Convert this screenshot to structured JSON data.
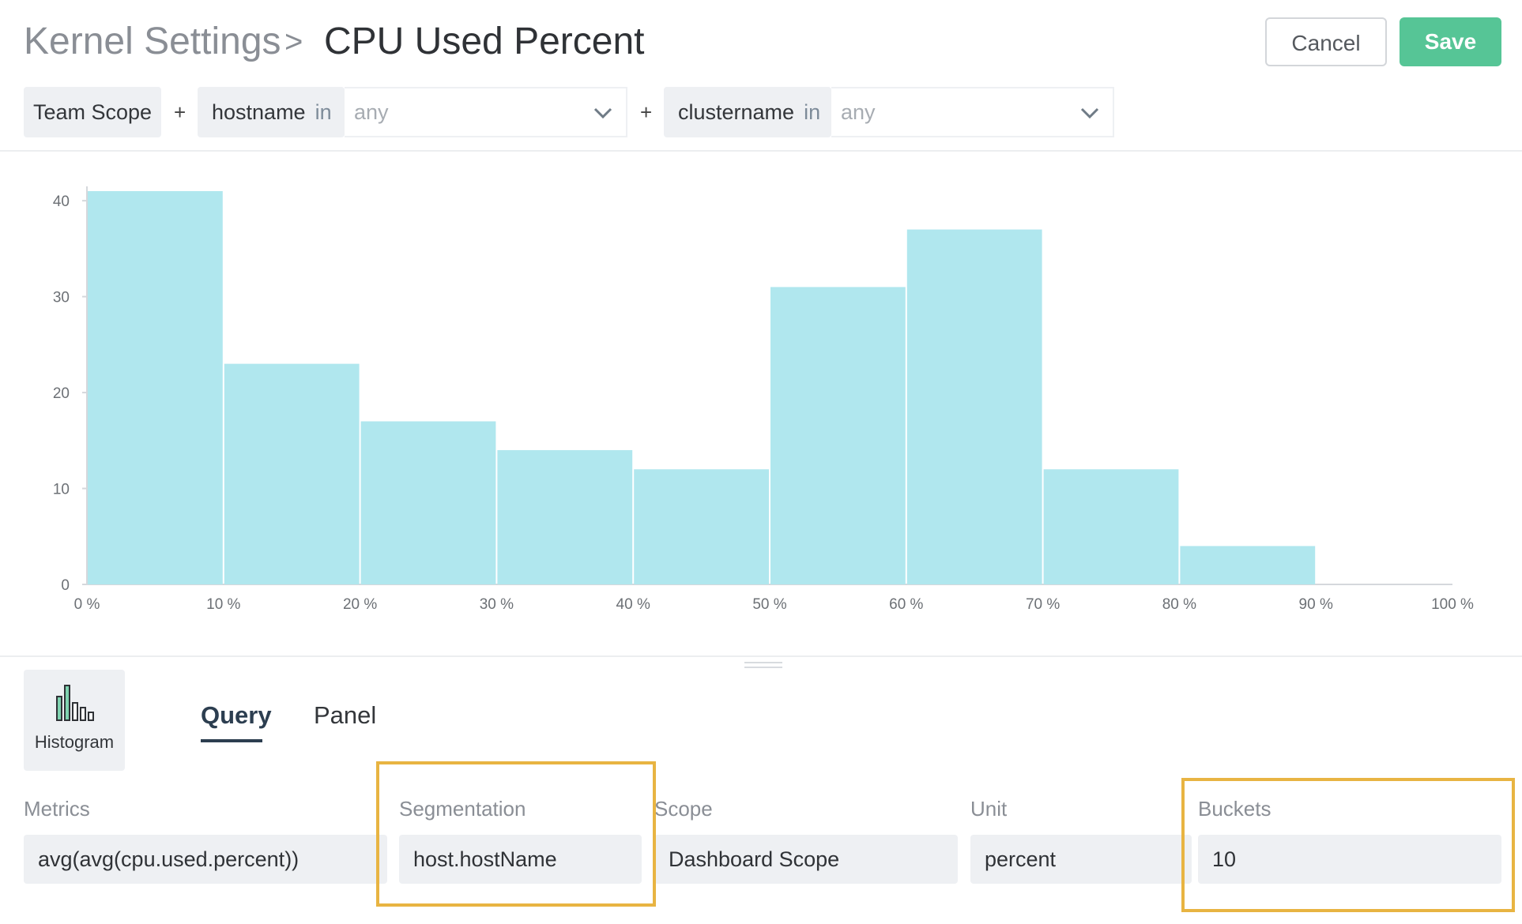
{
  "header": {
    "breadcrumb_root": "Kernel Settings",
    "breadcrumb_separator": ">",
    "page_title": "CPU Used Percent",
    "cancel_label": "Cancel",
    "save_label": "Save"
  },
  "scope_bar": {
    "team_scope": "Team Scope",
    "plus": "+",
    "filters": [
      {
        "key": "hostname",
        "operator": "in",
        "value": "any"
      },
      {
        "key": "clustername",
        "operator": "in",
        "value": "any"
      }
    ]
  },
  "chart_data": {
    "type": "bar",
    "categories": [
      "0 %",
      "10 %",
      "20 %",
      "30 %",
      "40 %",
      "50 %",
      "60 %",
      "70 %",
      "80 %",
      "90 %"
    ],
    "values": [
      41,
      23,
      17,
      14,
      12,
      31,
      37,
      12,
      4,
      0
    ],
    "x_ticks": [
      "0 %",
      "10 %",
      "20 %",
      "30 %",
      "40 %",
      "50 %",
      "60 %",
      "70 %",
      "80 %",
      "90 %",
      "100 %"
    ],
    "y_ticks": [
      "0",
      "10",
      "20",
      "30",
      "40"
    ],
    "ylim": [
      0,
      41
    ],
    "bar_color": "#b0e7ee",
    "grid": false
  },
  "visualization": {
    "icon": "histogram-icon",
    "label": "Histogram"
  },
  "tabs": [
    {
      "label": "Query",
      "active": true
    },
    {
      "label": "Panel",
      "active": false
    }
  ],
  "fields": {
    "metrics": {
      "label": "Metrics",
      "value": "avg(avg(cpu.used.percent))"
    },
    "segmentation": {
      "label": "Segmentation",
      "value": "host.hostName"
    },
    "scope": {
      "label": "Scope",
      "value": "Dashboard Scope"
    },
    "unit": {
      "label": "Unit",
      "value": "percent"
    },
    "buckets": {
      "label": "Buckets",
      "value": "10"
    }
  },
  "colors": {
    "save": "#56c596",
    "highlight": "#e8b442",
    "bar": "#b0e7ee"
  }
}
